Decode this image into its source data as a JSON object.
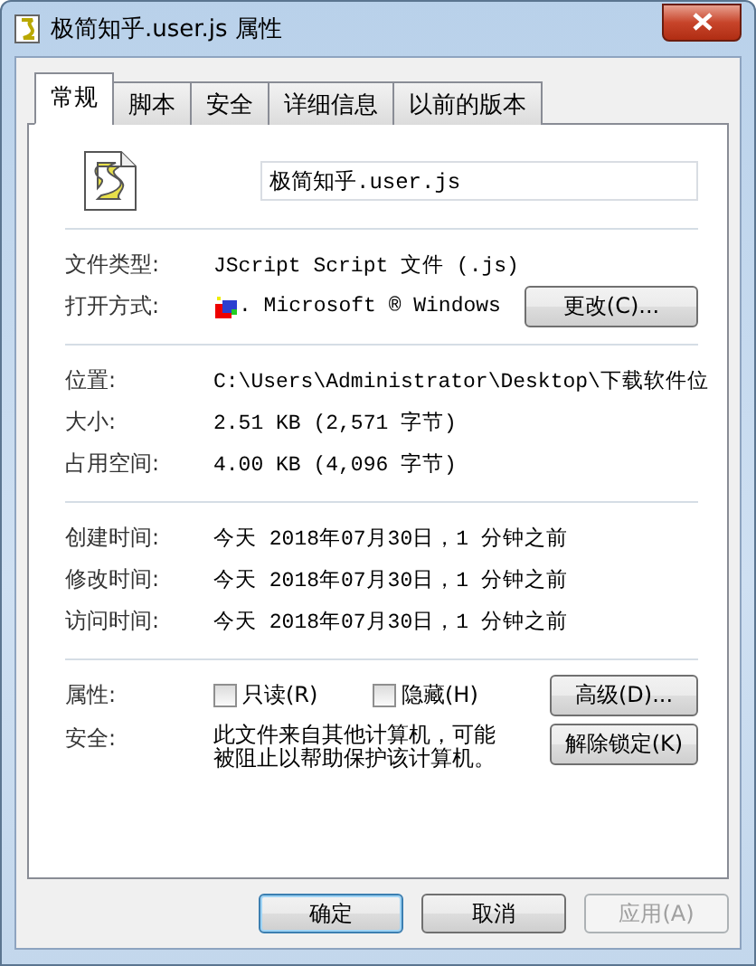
{
  "window": {
    "title": "极简知乎.user.js 属性"
  },
  "tabs": [
    {
      "label": "常规",
      "selected": true
    },
    {
      "label": "脚本",
      "selected": false
    },
    {
      "label": "安全",
      "selected": false
    },
    {
      "label": "详细信息",
      "selected": false
    },
    {
      "label": "以前的版本",
      "selected": false
    }
  ],
  "file_name": {
    "value": "极简知乎.user.js"
  },
  "sections": [
    [
      {
        "label": "文件类型:",
        "value": "JScript Script 文件 (.js)",
        "kind": "text"
      },
      {
        "label": "打开方式:",
        "value": ". Microsoft ® Windows",
        "kind": "app",
        "button": "更改(C)..."
      }
    ],
    [
      {
        "label": "位置:",
        "value": "C:\\Users\\Administrator\\Desktop\\下载软件位",
        "kind": "text"
      },
      {
        "label": "大小:",
        "value": "2.51 KB (2,571 字节)",
        "kind": "text"
      },
      {
        "label": "占用空间:",
        "value": "4.00 KB (4,096 字节)",
        "kind": "text"
      }
    ],
    [
      {
        "label": "创建时间:",
        "value": "今天 2018年07月30日，1 分钟之前",
        "kind": "text"
      },
      {
        "label": "修改时间:",
        "value": "今天 2018年07月30日，1 分钟之前",
        "kind": "text"
      },
      {
        "label": "访问时间:",
        "value": "今天 2018年07月30日，1 分钟之前",
        "kind": "text"
      }
    ]
  ],
  "attributes": {
    "label": "属性:",
    "checkboxes": [
      {
        "label": "只读(R)",
        "checked": false
      },
      {
        "label": "隐藏(H)",
        "checked": false
      }
    ],
    "button": "高级(D)..."
  },
  "security": {
    "label": "安全:",
    "text": "此文件来自其他计算机，可能被阻止以帮助保护该计算机。",
    "button": "解除锁定(K)"
  },
  "buttons": [
    {
      "label": "确定",
      "default": true,
      "disabled": false
    },
    {
      "label": "取消",
      "default": false,
      "disabled": false
    },
    {
      "label": "应用(A)",
      "default": false,
      "disabled": true
    }
  ]
}
